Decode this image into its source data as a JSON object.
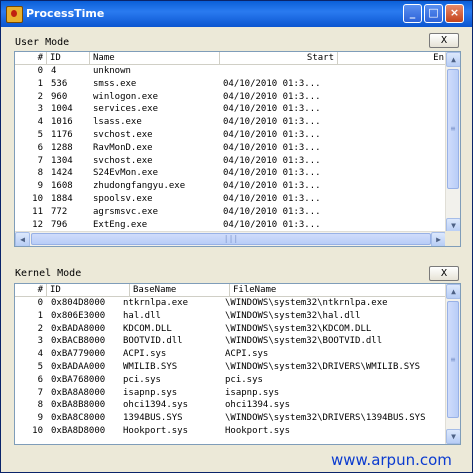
{
  "window": {
    "title": "ProcessTime",
    "minimize_glyph": "_",
    "maximize_glyph": "□",
    "close_glyph": "×"
  },
  "user_mode": {
    "label": "User Mode",
    "close_label": "X",
    "columns": [
      "#",
      "ID",
      "Name",
      "Start",
      "En"
    ],
    "rows": [
      [
        "0",
        "4",
        "unknown",
        ""
      ],
      [
        "1",
        "536",
        "smss.exe",
        "04/10/2010 01:3..."
      ],
      [
        "2",
        "960",
        "winlogon.exe",
        "04/10/2010 01:3..."
      ],
      [
        "3",
        "1004",
        "services.exe",
        "04/10/2010 01:3..."
      ],
      [
        "4",
        "1016",
        "lsass.exe",
        "04/10/2010 01:3..."
      ],
      [
        "5",
        "1176",
        "svchost.exe",
        "04/10/2010 01:3..."
      ],
      [
        "6",
        "1288",
        "RavMonD.exe",
        "04/10/2010 01:3..."
      ],
      [
        "7",
        "1304",
        "svchost.exe",
        "04/10/2010 01:3..."
      ],
      [
        "8",
        "1424",
        "S24EvMon.exe",
        "04/10/2010 01:3..."
      ],
      [
        "9",
        "1608",
        "zhudongfangyu.exe",
        "04/10/2010 01:3..."
      ],
      [
        "10",
        "1884",
        "spoolsv.exe",
        "04/10/2010 01:3..."
      ],
      [
        "11",
        "772",
        "agrsmsvc.exe",
        "04/10/2010 01:3..."
      ],
      [
        "12",
        "796",
        "ExtEng.exe",
        "04/10/2010 01:3..."
      ]
    ]
  },
  "kernel_mode": {
    "label": "Kernel Mode",
    "close_label": "X",
    "columns": [
      "#",
      "ID",
      "BaseName",
      "FileName"
    ],
    "rows": [
      [
        "0",
        "0x804D8000",
        "ntkrnlpa.exe",
        "\\WINDOWS\\system32\\ntkrnlpa.exe"
      ],
      [
        "1",
        "0x806E3000",
        "hal.dll",
        "\\WINDOWS\\system32\\hal.dll"
      ],
      [
        "2",
        "0xBADA8000",
        "KDCOM.DLL",
        "\\WINDOWS\\system32\\KDCOM.DLL"
      ],
      [
        "3",
        "0xBACB8000",
        "BOOTVID.dll",
        "\\WINDOWS\\system32\\BOOTVID.dll"
      ],
      [
        "4",
        "0xBA779000",
        "ACPI.sys",
        "ACPI.sys"
      ],
      [
        "5",
        "0xBADAA000",
        "WMILIB.SYS",
        "\\WINDOWS\\system32\\DRIVERS\\WMILIB.SYS"
      ],
      [
        "6",
        "0xBA768000",
        "pci.sys",
        "pci.sys"
      ],
      [
        "7",
        "0xBA8A8000",
        "isapnp.sys",
        "isapnp.sys"
      ],
      [
        "8",
        "0xBA8B8000",
        "ohci1394.sys",
        "ohci1394.sys"
      ],
      [
        "9",
        "0xBA8C8000",
        "1394BUS.SYS",
        "\\WINDOWS\\system32\\DRIVERS\\1394BUS.SYS"
      ],
      [
        "10",
        "0xBA8D8000",
        "Hookport.sys",
        "Hookport.sys"
      ]
    ]
  },
  "watermark": "www.arpun.com"
}
